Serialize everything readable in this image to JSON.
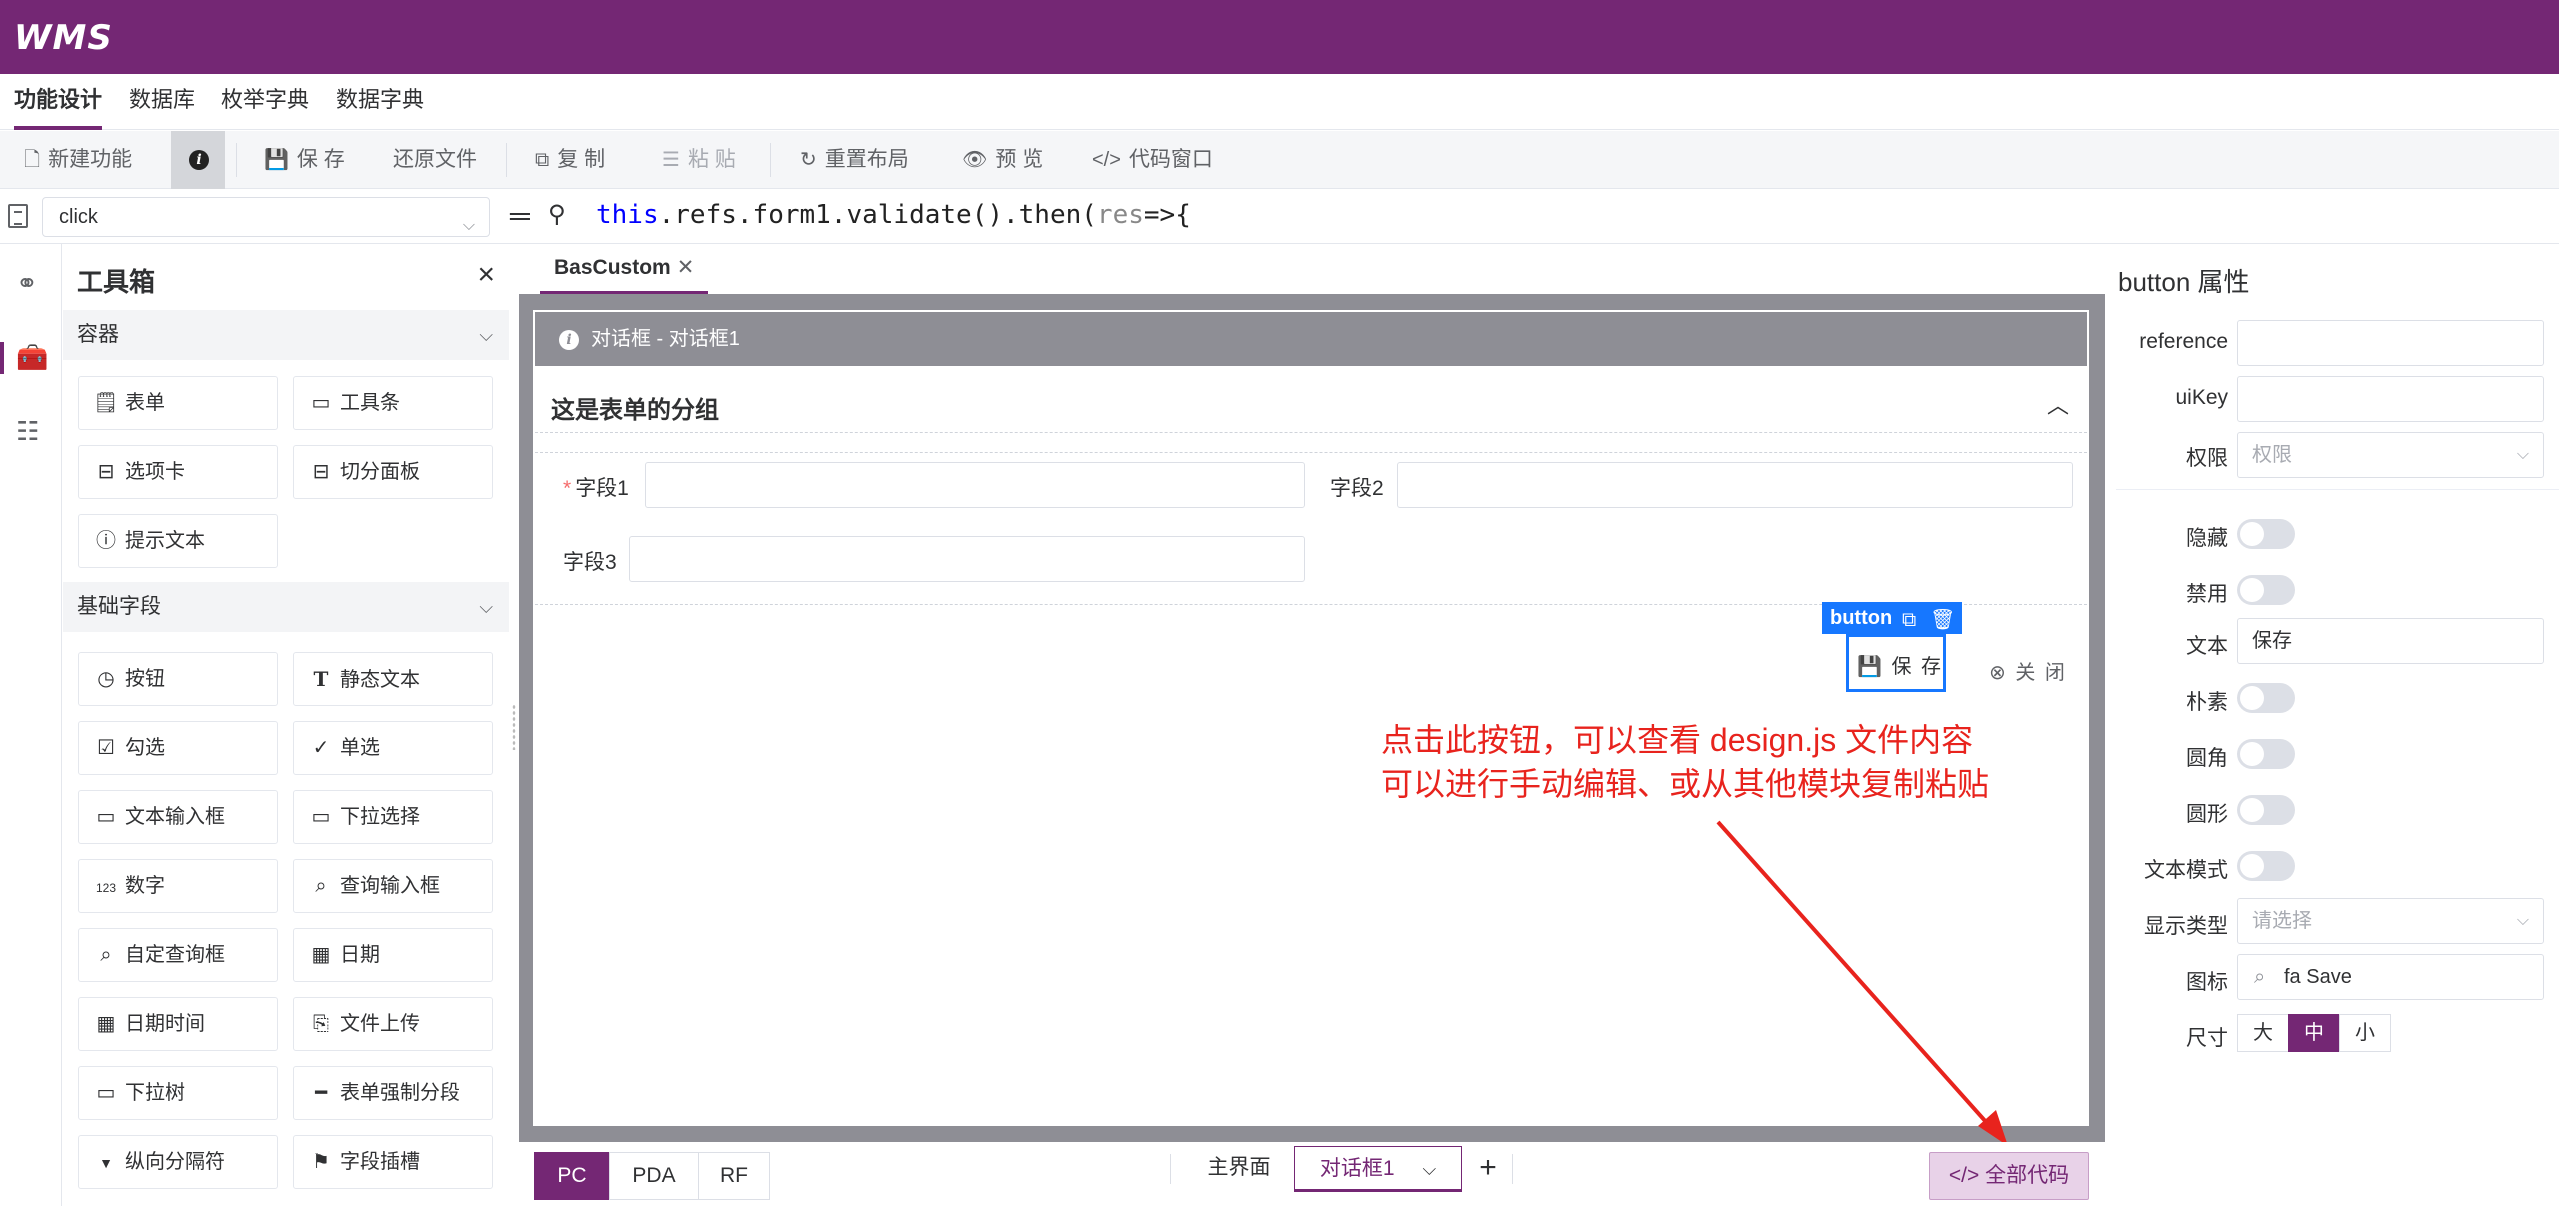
{
  "app": {
    "logo": "WMS",
    "accent": "#742774"
  },
  "main_nav": [
    {
      "label": "功能设计",
      "active": true
    },
    {
      "label": "数据库"
    },
    {
      "label": "枚举字典"
    },
    {
      "label": "数据字典"
    }
  ],
  "toolbar": {
    "new": "新建功能",
    "save": "保 存",
    "restore": "还原文件",
    "copy": "复 制",
    "paste": "粘 贴",
    "reset_layout": "重置布局",
    "preview": "预 览",
    "code_window": "代码窗口"
  },
  "code_row": {
    "event": "click",
    "code_kw": "this",
    "code_mid": ".refs.form1.validate().then(",
    "code_arg": "res",
    "code_end": "=>{"
  },
  "toolbox": {
    "title": "工具箱",
    "sections": [
      {
        "title": "容器",
        "items": [
          "表单",
          "工具条",
          "选项卡",
          "切分面板",
          "提示文本"
        ]
      },
      {
        "title": "基础字段",
        "items": [
          "按钮",
          "静态文本",
          "勾选",
          "单选",
          "文本输入框",
          "下拉选择",
          "数字",
          "查询输入框",
          "自定查询框",
          "日期",
          "日期时间",
          "文件上传",
          "下拉树",
          "表单强制分段",
          "纵向分隔符",
          "字段插槽"
        ]
      }
    ]
  },
  "design": {
    "tab": "BasCustom",
    "dialog_title": "对话框 - 对话框1",
    "group_title": "这是表单的分组",
    "fields": [
      "字段1",
      "字段2",
      "字段3"
    ],
    "button_tag": "button",
    "save_btn": "保 存",
    "close_btn": "关 闭",
    "annotation_line1": "点击此按钮，可以查看 design.js 文件内容",
    "annotation_line2": "可以进行手动编辑、或从其他模块复制粘贴"
  },
  "bottom": {
    "modes": [
      "PC",
      "PDA",
      "RF"
    ],
    "active_mode": "PC",
    "pages": [
      "主界面",
      "对话框1"
    ],
    "active_page": "对话框1",
    "all_code": "全部代码"
  },
  "props": {
    "title": "button 属性",
    "reference_label": "reference",
    "uikey_label": "uiKey",
    "perm_label": "权限",
    "perm_placeholder": "权限",
    "hidden_label": "隐藏",
    "disabled_label": "禁用",
    "text_label": "文本",
    "text_value": "保存",
    "plain_label": "朴素",
    "round_label": "圆角",
    "circle_label": "圆形",
    "textmode_label": "文本模式",
    "type_label": "显示类型",
    "type_placeholder": "请选择",
    "icon_label": "图标",
    "icon_value": "fa Save",
    "size_label": "尺寸",
    "sizes": [
      "大",
      "中",
      "小"
    ],
    "active_size": "中"
  }
}
